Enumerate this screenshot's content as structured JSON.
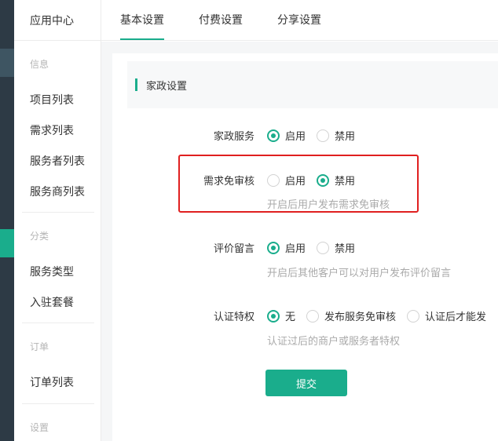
{
  "colors": {
    "accent": "#1aad8c",
    "highlight_border": "#e02020",
    "rail": "#2d3a45"
  },
  "sidebar": {
    "header": "应用中心",
    "groups": [
      {
        "title": "信息",
        "items": [
          "项目列表",
          "需求列表",
          "服务者列表",
          "服务商列表"
        ]
      },
      {
        "title": "分类",
        "items": [
          "服务类型",
          "入驻套餐"
        ]
      },
      {
        "title": "订单",
        "items": [
          "订单列表"
        ]
      },
      {
        "title": "设置",
        "items": []
      }
    ]
  },
  "tabs": [
    {
      "label": "基本设置",
      "active": true
    },
    {
      "label": "付费设置",
      "active": false
    },
    {
      "label": "分享设置",
      "active": false
    }
  ],
  "section": {
    "title": "家政设置"
  },
  "fields": [
    {
      "label": "家政服务",
      "options": [
        "启用",
        "禁用"
      ],
      "selected": 0,
      "hint": ""
    },
    {
      "label": "需求免审核",
      "options": [
        "启用",
        "禁用"
      ],
      "selected": 1,
      "hint": "开启后用户发布需求免审核"
    },
    {
      "label": "评价留言",
      "options": [
        "启用",
        "禁用"
      ],
      "selected": 0,
      "hint": "开启后其他客户可以对用户发布评价留言"
    },
    {
      "label": "认证特权",
      "options": [
        "无",
        "发布服务免审核",
        "认证后才能发"
      ],
      "selected": 0,
      "hint": "认证过后的商户或服务者特权"
    }
  ],
  "submit_label": "提交"
}
